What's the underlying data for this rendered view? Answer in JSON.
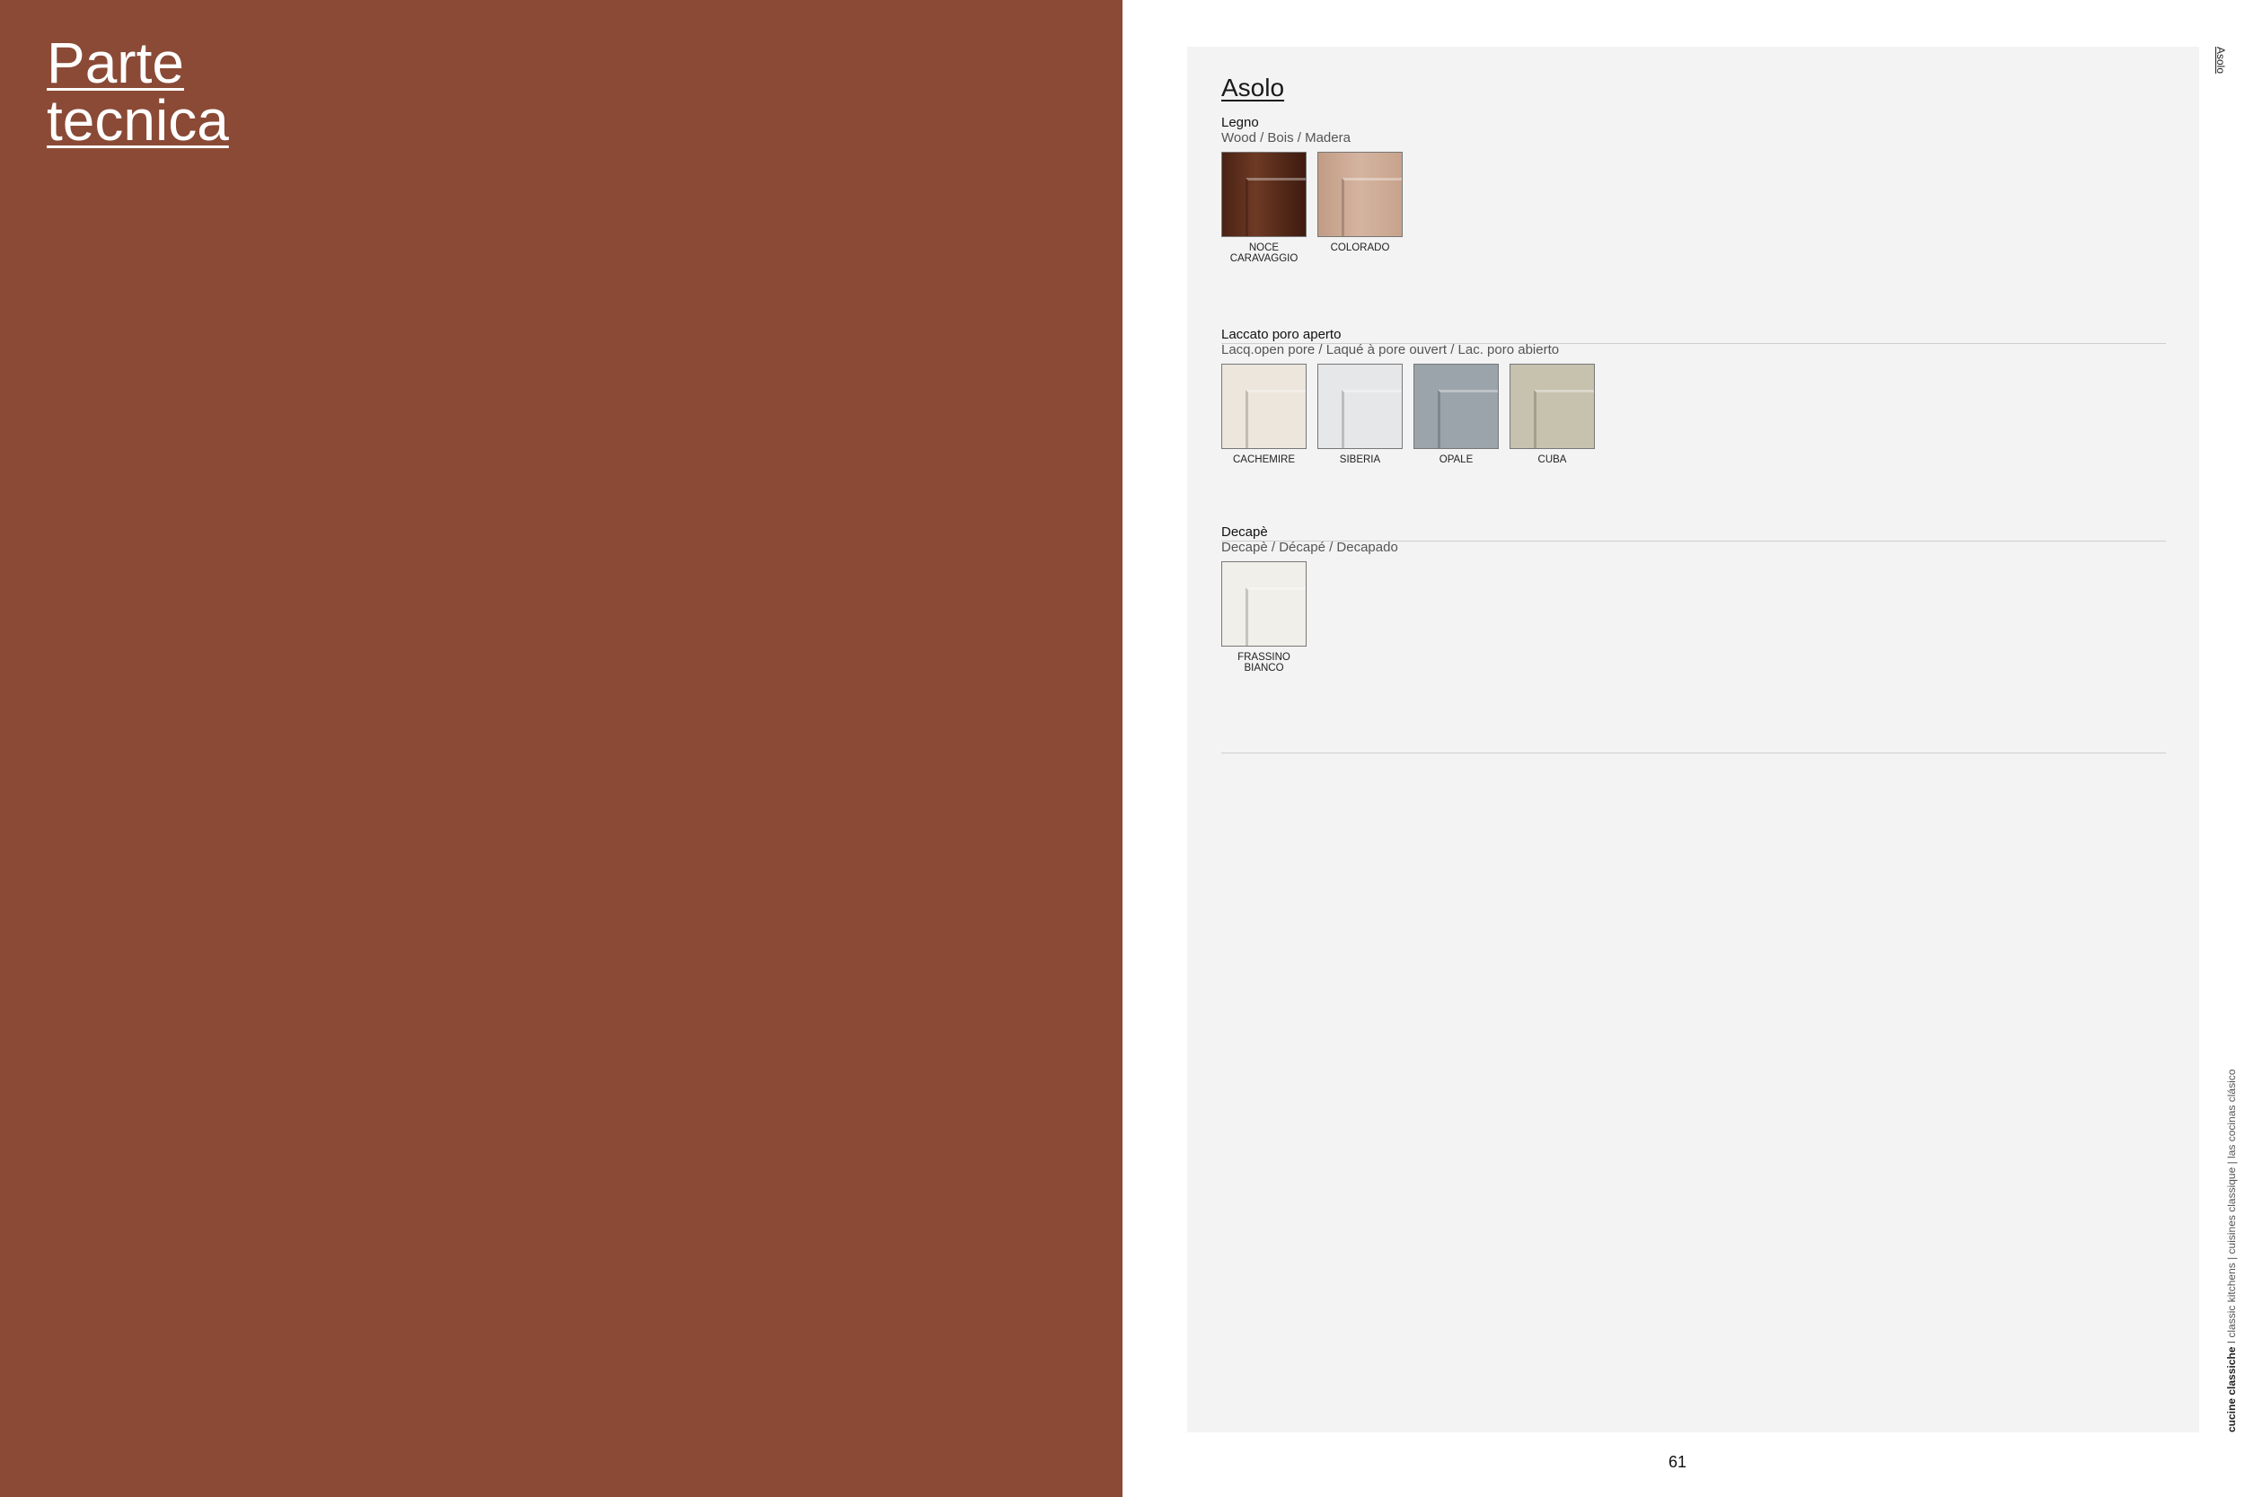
{
  "left": {
    "title_line1": "Parte",
    "title_line2": "tecnica",
    "background": "#8a4a36"
  },
  "page": {
    "model_title": "Asolo",
    "side_top": "Asolo",
    "side_bottom_bold": "cucine classiche",
    "side_bottom_rest": " I classic kitchens | cuisines classique | las cocinas clásico",
    "page_number": "61"
  },
  "sections": [
    {
      "title": "Legno",
      "subtitle": "Wood / Bois / Madera",
      "swatches": [
        {
          "label": "NOCE CARAVAGGIO",
          "color": "#5a2e1c"
        },
        {
          "label": "COLORADO",
          "color": "#c9a58f"
        }
      ]
    },
    {
      "title": "Laccato poro aperto",
      "subtitle": "Lacq.open pore / Laqué à pore ouvert / Lac. poro abierto",
      "swatches": [
        {
          "label": "CACHEMIRE",
          "color": "#ece6dc"
        },
        {
          "label": "SIBERIA",
          "color": "#e6e7e8"
        },
        {
          "label": "OPALE",
          "color": "#9aa4aa"
        },
        {
          "label": "CUBA",
          "color": "#c7c2ae"
        }
      ]
    },
    {
      "title": "Decapè",
      "subtitle": "Decapè / Décapé / Decapado",
      "swatches": [
        {
          "label": "FRASSINO BIANCO",
          "color": "#f1efea"
        }
      ]
    }
  ]
}
